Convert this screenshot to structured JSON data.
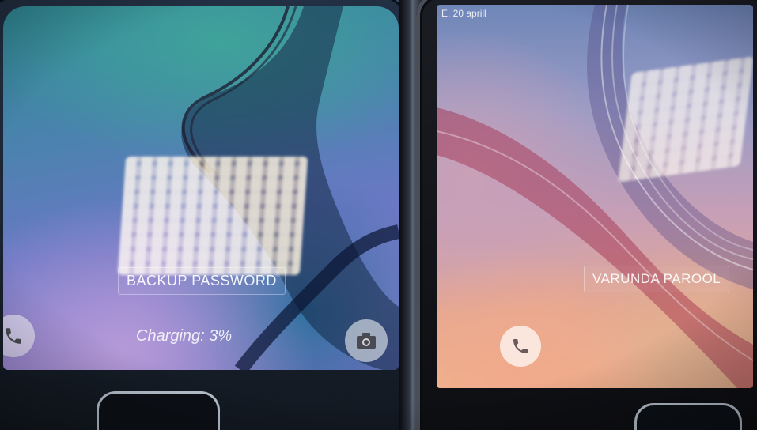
{
  "left_phone": {
    "lock_label": "BACKUP PASSWORD",
    "status": "Charging: 3%",
    "icons": {
      "phone": "phone-icon",
      "camera": "camera-icon"
    }
  },
  "right_phone": {
    "date": "E, 20 aprill",
    "lock_label": "VARUNDA PAROOL",
    "icons": {
      "phone": "phone-icon"
    }
  },
  "colors": {
    "left_screen": "#4d82b0",
    "right_screen": "#e5a892",
    "bezel": "#121820"
  }
}
